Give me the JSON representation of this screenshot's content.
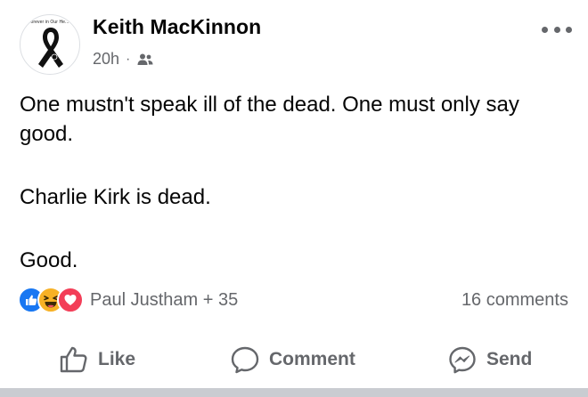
{
  "post": {
    "author": "Keith MacKinnon",
    "avatar_caption": "orever in Our He...",
    "time": "20h",
    "separator": "·",
    "audience_icon": "friends-icon",
    "more_icon": "more-horizontal-icon",
    "body": [
      "One mustn't speak ill of the dead. One must only say good.",
      "Charlie Kirk is dead.",
      "Good."
    ],
    "reactions": {
      "icons": [
        "like-reaction-icon",
        "haha-reaction-icon",
        "love-reaction-icon"
      ],
      "summary": "Paul Justham + 35"
    },
    "comments_count": "16 comments",
    "actions": {
      "like": "Like",
      "comment": "Comment",
      "send": "Send"
    }
  },
  "colors": {
    "text_primary": "#050505",
    "text_secondary": "#65676b",
    "like_blue": "#1877f2",
    "haha_yellow": "#f7b125",
    "love_red": "#f33e58",
    "messenger_icon": "#65676b"
  }
}
